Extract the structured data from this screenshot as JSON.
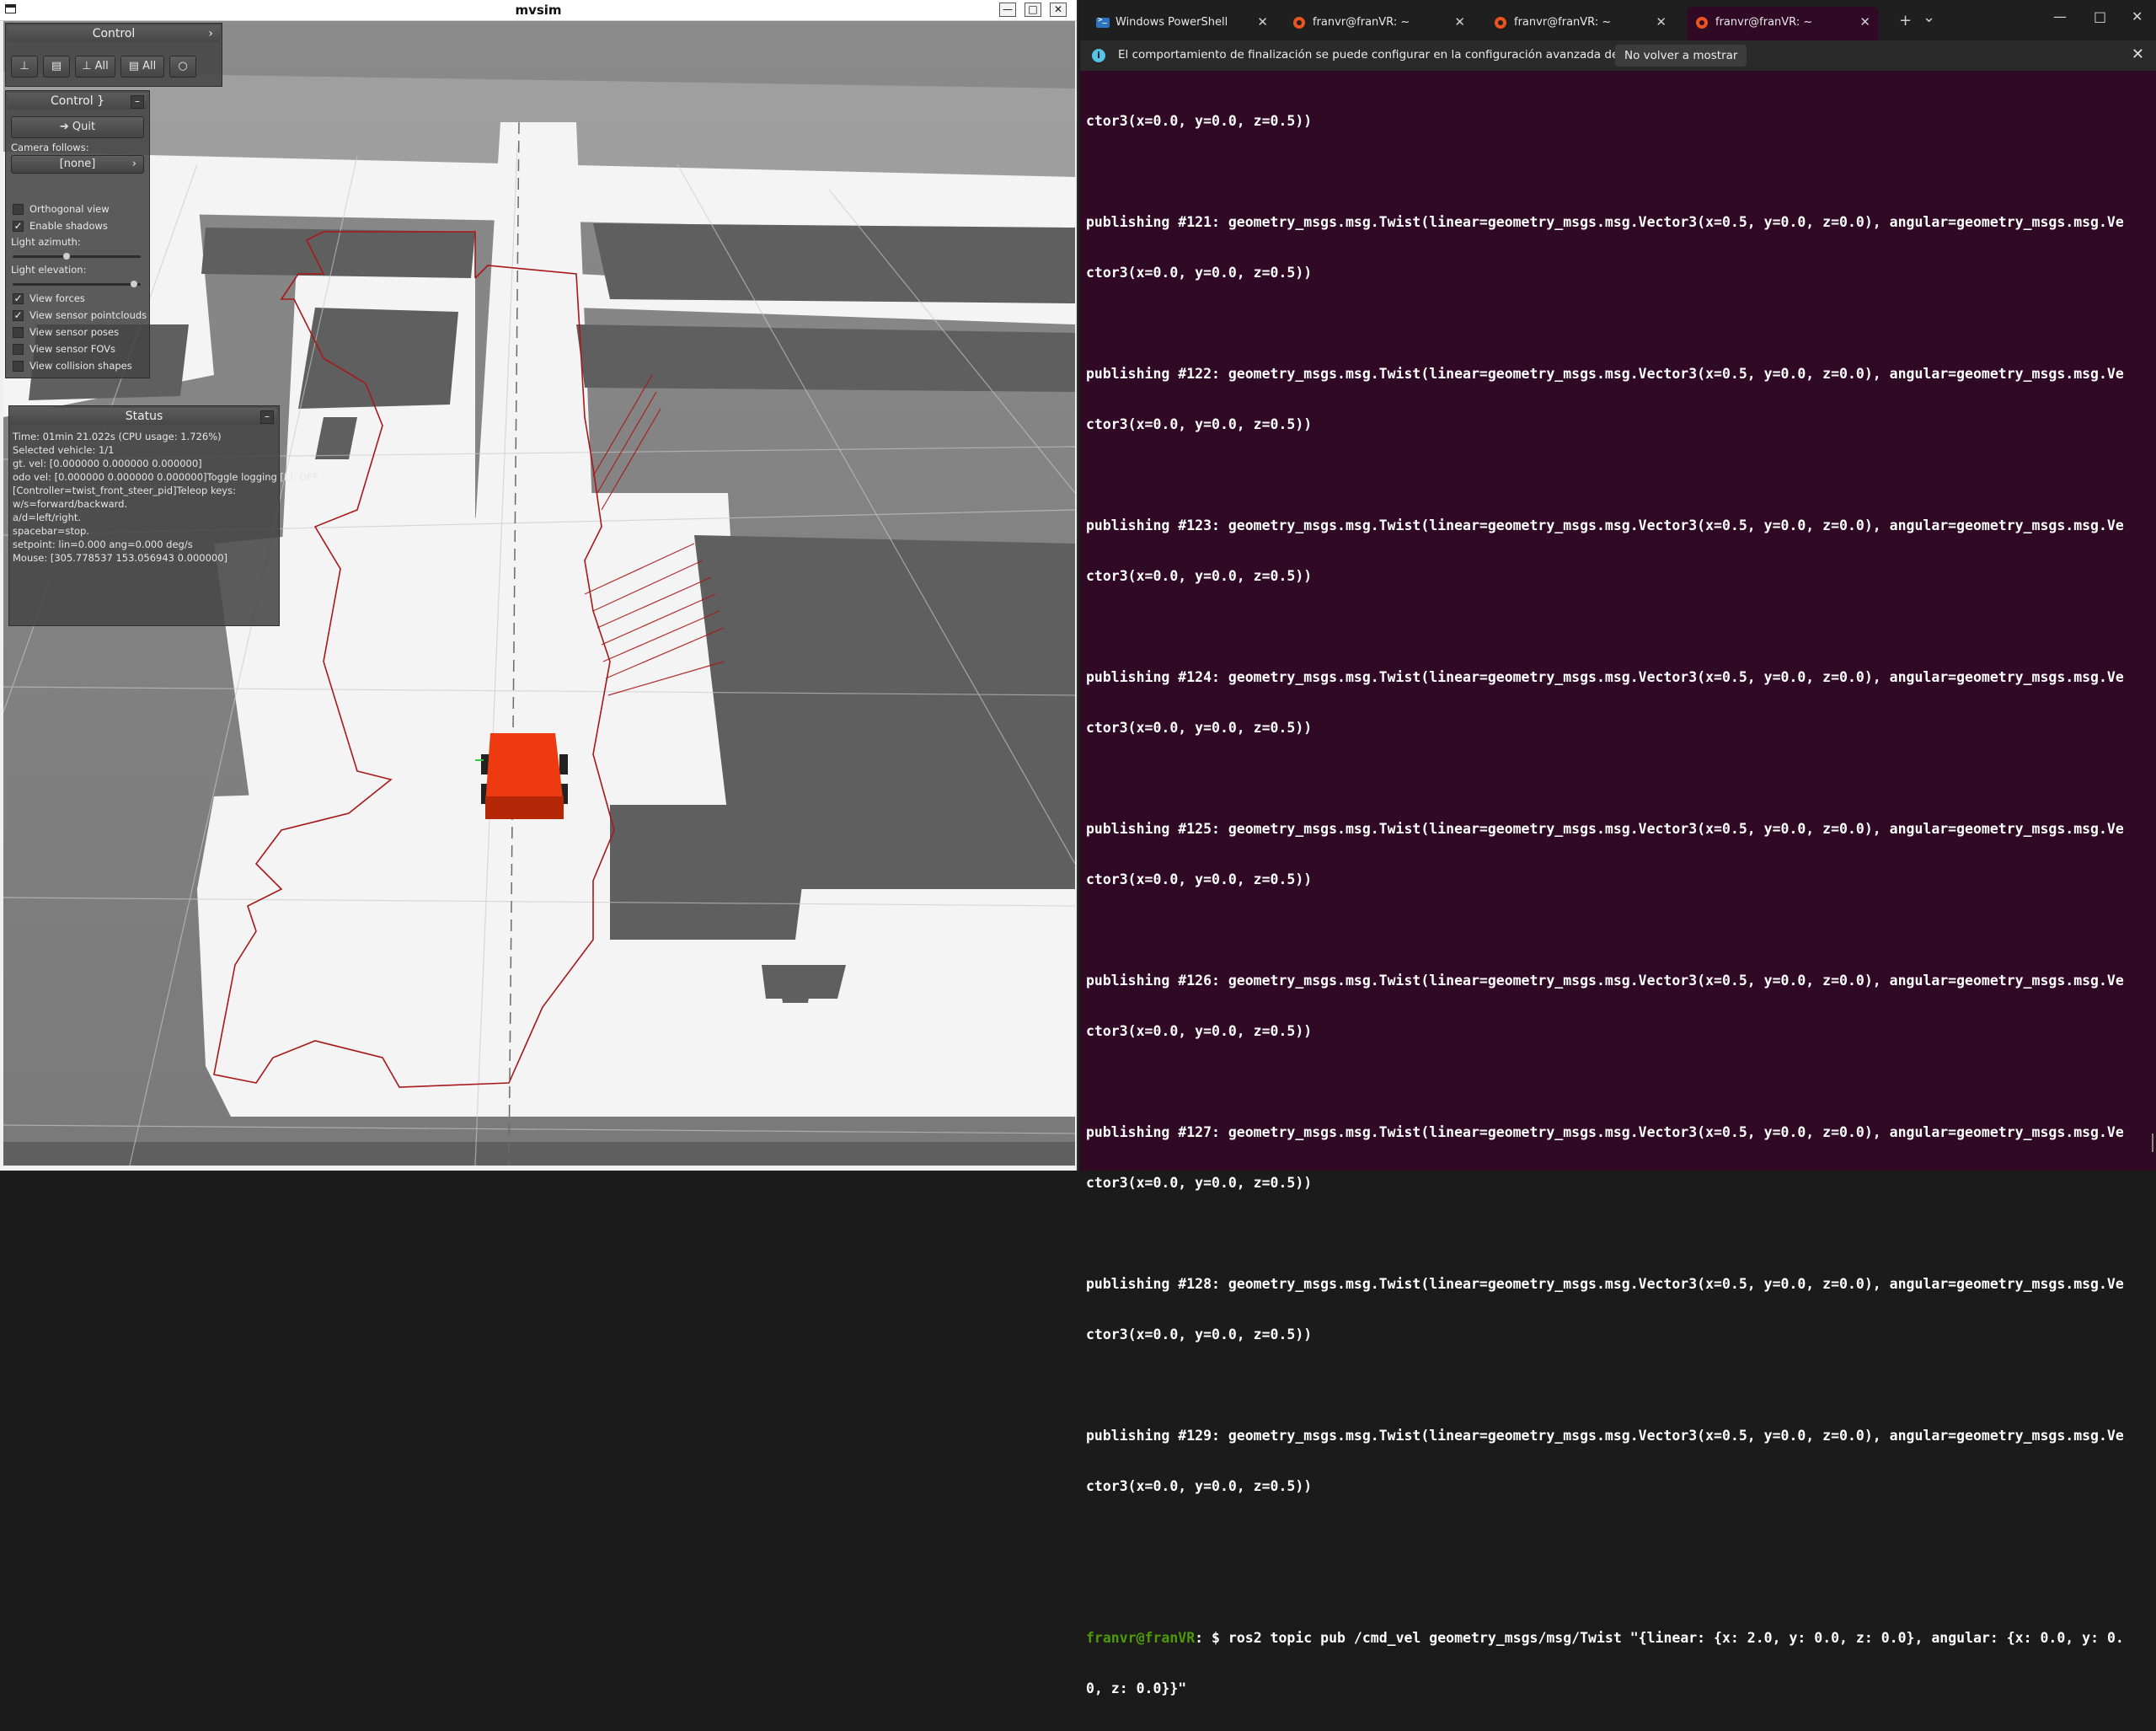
{
  "mvsim": {
    "title": "mvsim",
    "minimize_glyph": "—",
    "maximize_glyph": "□",
    "close_glyph": "✕",
    "top_panel": {
      "title": "Control",
      "title_arrow": "›",
      "buttons": [
        "⊥",
        "▤",
        "⊥ All",
        "▤ All",
        "○"
      ]
    },
    "control_panel": {
      "title": "Control",
      "collapse_glyph": "–",
      "quit_label": "➔ Quit",
      "camera_follows_label": "Camera follows:",
      "camera_follows_value": "[none]",
      "camera_arrow": "›",
      "checkboxes": [
        {
          "label": "Orthogonal view",
          "checked": false
        },
        {
          "label": "Enable shadows",
          "checked": true
        }
      ],
      "light_azimuth_label": "Light azimuth:",
      "light_azimuth_level": 0.42,
      "light_elevation_label": "Light elevation:",
      "light_elevation_level": 0.95,
      "view_checkboxes": [
        {
          "label": "View forces",
          "checked": true
        },
        {
          "label": "View sensor pointclouds",
          "checked": true
        },
        {
          "label": "View sensor poses",
          "checked": false
        },
        {
          "label": "View sensor FOVs",
          "checked": false
        },
        {
          "label": "View collision shapes",
          "checked": false
        }
      ]
    },
    "status_panel": {
      "title": "Status",
      "collapse_glyph": "–",
      "lines": [
        "Time: 01min 21.022s (CPU usage: 1.726%)",
        "Selected vehicle: 1/1",
        "gt. vel: [0.000000 0.000000 0.000000]",
        "odo vel: [0.000000 0.000000 0.000000]Toggle logging [L]: OFF",
        "[Controller=twist_front_steer_pid]Teleop keys:",
        "w/s=forward/backward.",
        "a/d=left/right.",
        "spacebar=stop.",
        "setpoint: lin=0.000 ang=0.000 deg/s",
        "Mouse: [305.778537 153.056943 0.000000]"
      ]
    },
    "colors": {
      "robot": "#ee3a10",
      "laser": "#a81818",
      "ground": "#7b7b7b",
      "free_space": "#ffffff",
      "walls": "#5f5f5f"
    }
  },
  "terminal": {
    "tabs": [
      {
        "label": "Windows PowerShell",
        "icon": "powershell-icon",
        "active": false
      },
      {
        "label": "franvr@franVR: ~",
        "icon": "ubuntu-icon",
        "active": false
      },
      {
        "label": "franvr@franVR: ~",
        "icon": "ubuntu-icon",
        "active": false
      },
      {
        "label": "franvr@franVR: ~",
        "icon": "ubuntu-icon",
        "active": true
      }
    ],
    "tab_close_glyph": "✕",
    "new_tab_glyph": "+",
    "dropdown_glyph": "⌄",
    "win_min": "—",
    "win_max": "□",
    "win_close": "✕",
    "info": {
      "icon": "i",
      "text": "El comportamiento de finalización se puede configurar en la configuración avanzada del perfil.",
      "dismiss": "No volver a mostrar",
      "close": "✕"
    },
    "lines": [
      "ctor3(x=0.0, y=0.0, z=0.5))",
      "",
      "publishing #121: geometry_msgs.msg.Twist(linear=geometry_msgs.msg.Vector3(x=0.5, y=0.0, z=0.0), angular=geometry_msgs.msg.Ve",
      "ctor3(x=0.0, y=0.0, z=0.5))",
      "",
      "publishing #122: geometry_msgs.msg.Twist(linear=geometry_msgs.msg.Vector3(x=0.5, y=0.0, z=0.0), angular=geometry_msgs.msg.Ve",
      "ctor3(x=0.0, y=0.0, z=0.5))",
      "",
      "publishing #123: geometry_msgs.msg.Twist(linear=geometry_msgs.msg.Vector3(x=0.5, y=0.0, z=0.0), angular=geometry_msgs.msg.Ve",
      "ctor3(x=0.0, y=0.0, z=0.5))",
      "",
      "publishing #124: geometry_msgs.msg.Twist(linear=geometry_msgs.msg.Vector3(x=0.5, y=0.0, z=0.0), angular=geometry_msgs.msg.Ve",
      "ctor3(x=0.0, y=0.0, z=0.5))",
      "",
      "publishing #125: geometry_msgs.msg.Twist(linear=geometry_msgs.msg.Vector3(x=0.5, y=0.0, z=0.0), angular=geometry_msgs.msg.Ve",
      "ctor3(x=0.0, y=0.0, z=0.5))",
      "",
      "publishing #126: geometry_msgs.msg.Twist(linear=geometry_msgs.msg.Vector3(x=0.5, y=0.0, z=0.0), angular=geometry_msgs.msg.Ve",
      "ctor3(x=0.0, y=0.0, z=0.5))",
      "",
      "publishing #127: geometry_msgs.msg.Twist(linear=geometry_msgs.msg.Vector3(x=0.5, y=0.0, z=0.0), angular=geometry_msgs.msg.Ve",
      "ctor3(x=0.0, y=0.0, z=0.5))",
      "",
      "publishing #128: geometry_msgs.msg.Twist(linear=geometry_msgs.msg.Vector3(x=0.5, y=0.0, z=0.0), angular=geometry_msgs.msg.Ve",
      "ctor3(x=0.0, y=0.0, z=0.5))",
      "",
      "publishing #129: geometry_msgs.msg.Twist(linear=geometry_msgs.msg.Vector3(x=0.5, y=0.0, z=0.0), angular=geometry_msgs.msg.Ve",
      "ctor3(x=0.0, y=0.0, z=0.5))",
      ""
    ],
    "prompt": {
      "user": "franvr@franVR",
      "sep": ":",
      "path": " ",
      "symbol": "$",
      "command_line1": " ros2 topic pub /cmd_vel geometry_msgs/msg/Twist \"{linear: {x: 2.0, y: 0.0, z: 0.0}, angular: {x: 0.0, y: 0.",
      "command_line2": "0, z: 0.0}}\""
    },
    "colors": {
      "background": "#300a24",
      "prompt_user": "#4e9a06",
      "prompt_path": "#3465a4",
      "tab_accent": "#e95420"
    }
  }
}
